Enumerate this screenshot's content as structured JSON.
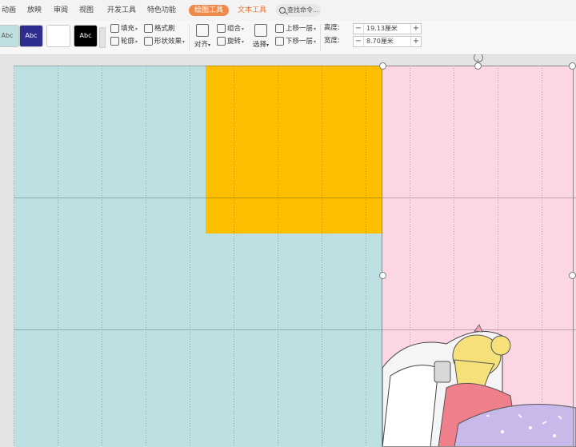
{
  "tabs": [
    {
      "label": "动画"
    },
    {
      "label": "放映"
    },
    {
      "label": "审阅"
    },
    {
      "label": "视图"
    },
    {
      "label": "开发工具"
    },
    {
      "label": "特色功能"
    },
    {
      "label": "绘图工具"
    },
    {
      "label": "文本工具"
    }
  ],
  "search": {
    "label": "查找命令..."
  },
  "styles": [
    {
      "label": "Abc",
      "bg": "#bfe0e0",
      "fg": "#555555"
    },
    {
      "label": "Abc",
      "bg": "#2e2e8e",
      "fg": "#ffffff"
    },
    {
      "label": "",
      "bg": "#ffffff",
      "fg": "#333333"
    },
    {
      "label": "Abc",
      "bg": "#000000",
      "fg": "#ffffff"
    }
  ],
  "ribbon": {
    "fill": "填充",
    "format_painter": "格式刷",
    "outline": "轮廓",
    "shape_effects": "形状效果",
    "align": "对齐",
    "group": "组合",
    "rotate": "旋转",
    "select": "选择",
    "bring_forward": "上移一层",
    "send_backward": "下移一层",
    "height_label": "高度:",
    "height_value": "19.13厘米",
    "width_label": "宽度:",
    "width_value": "8.70厘米",
    "minus": "−",
    "plus": "+"
  },
  "colors": {
    "accent": "#f08a4b",
    "blue_rect": "#bde0e2",
    "orange_rect": "#fdbf00",
    "pink_rect": "#fdd6e5"
  }
}
